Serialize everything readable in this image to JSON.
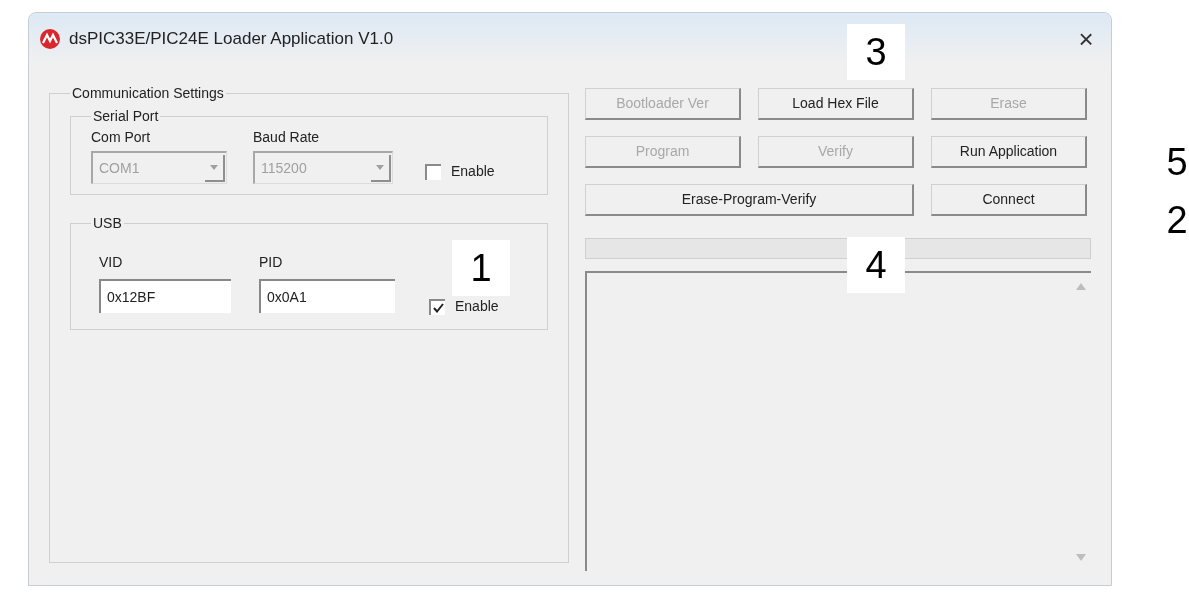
{
  "window": {
    "title": "dsPIC33E/PIC24E Loader Application V1.0",
    "close": "×"
  },
  "communication_settings": {
    "title": "Communication Settings",
    "serial_port": {
      "title": "Serial Port",
      "com_port": {
        "label": "Com Port",
        "value": "COM1",
        "disabled": true
      },
      "baud_rate": {
        "label": "Baud Rate",
        "value": "115200",
        "disabled": true
      },
      "enable": {
        "label": "Enable",
        "checked": false
      }
    },
    "usb": {
      "title": "USB",
      "vid": {
        "label": "VID",
        "value": "0x12BF"
      },
      "pid": {
        "label": "PID",
        "value": "0x0A1"
      },
      "enable": {
        "label": "Enable",
        "checked": true
      }
    }
  },
  "buttons": [
    {
      "label": "Bootloader Ver",
      "disabled": true
    },
    {
      "label": "Load Hex File",
      "disabled": false
    },
    {
      "label": "Erase",
      "disabled": true
    },
    {
      "label": "Program",
      "disabled": true
    },
    {
      "label": "Verify",
      "disabled": true
    },
    {
      "label": "Run Application",
      "disabled": false
    },
    {
      "label": "Erase-Program-Verify",
      "disabled": false
    },
    {
      "label": "Connect",
      "disabled": false
    }
  ],
  "callouts": [
    "1",
    "3",
    "4",
    "5",
    "2"
  ]
}
